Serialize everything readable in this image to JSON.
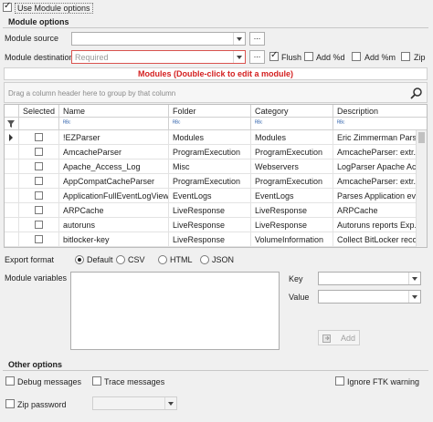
{
  "use_module_options": {
    "label": "Use Module options",
    "checked": true
  },
  "module_options": {
    "title": "Module options",
    "module_source_label": "Module source",
    "module_source_value": "",
    "module_destination_label": "Module destination",
    "module_destination_placeholder": "Required",
    "browse_label": "...",
    "flush": {
      "label": "Flush",
      "checked": true
    },
    "add_d": {
      "label": "Add %d",
      "checked": false
    },
    "add_m": {
      "label": "Add %m",
      "checked": false
    },
    "zip": {
      "label": "Zip",
      "checked": false
    },
    "modules_banner": "Modules (Double-click to edit a module)",
    "group_hint": "Drag a column header here to group by that column",
    "columns": [
      "Selected",
      "Name",
      "Folder",
      "Category",
      "Description"
    ],
    "filter_glyph": "ᴿᴮᶜ",
    "rows": [
      {
        "name": "!EZParser",
        "folder": "Modules",
        "category": "Modules",
        "description": "Eric Zimmerman Parsers"
      },
      {
        "name": "AmcacheParser",
        "folder": "ProgramExecution",
        "category": "ProgramExecution",
        "description": "AmcacheParser: extr..."
      },
      {
        "name": "Apache_Access_Log",
        "folder": "Misc",
        "category": "Webservers",
        "description": "LogParser Apache Acc..."
      },
      {
        "name": "AppCompatCacheParser",
        "folder": "ProgramExecution",
        "category": "ProgramExecution",
        "description": "AmcacheParser: extr..."
      },
      {
        "name": "ApplicationFullEventLogView",
        "folder": "EventLogs",
        "category": "EventLogs",
        "description": "Parses Application ev..."
      },
      {
        "name": "ARPCache",
        "folder": "LiveResponse",
        "category": "LiveResponse",
        "description": "ARPCache"
      },
      {
        "name": "autoruns",
        "folder": "LiveResponse",
        "category": "LiveResponse",
        "description": "Autoruns reports Exp..."
      },
      {
        "name": "bitlocker-key",
        "folder": "LiveResponse",
        "category": "VolumeInformation",
        "description": "Collect BitLocker reco..."
      }
    ],
    "export_format_label": "Export format",
    "export_formats": [
      {
        "label": "Default",
        "selected": true
      },
      {
        "label": "CSV",
        "selected": false
      },
      {
        "label": "HTML",
        "selected": false
      },
      {
        "label": "JSON",
        "selected": false
      }
    ],
    "module_variables_label": "Module variables",
    "key_label": "Key",
    "value_label": "Value",
    "add_button_label": "Add"
  },
  "other_options": {
    "title": "Other options",
    "debug_messages": {
      "label": "Debug messages",
      "checked": false
    },
    "trace_messages": {
      "label": "Trace messages",
      "checked": false
    },
    "ignore_ftk_warning": {
      "label": "Ignore FTK warning",
      "checked": false
    },
    "zip_password": {
      "label": "Zip password",
      "checked": false
    }
  },
  "colors": {
    "required_border": "#d9534f",
    "banner_text": "#d42020",
    "accent_blue": "#3a6ab0"
  }
}
